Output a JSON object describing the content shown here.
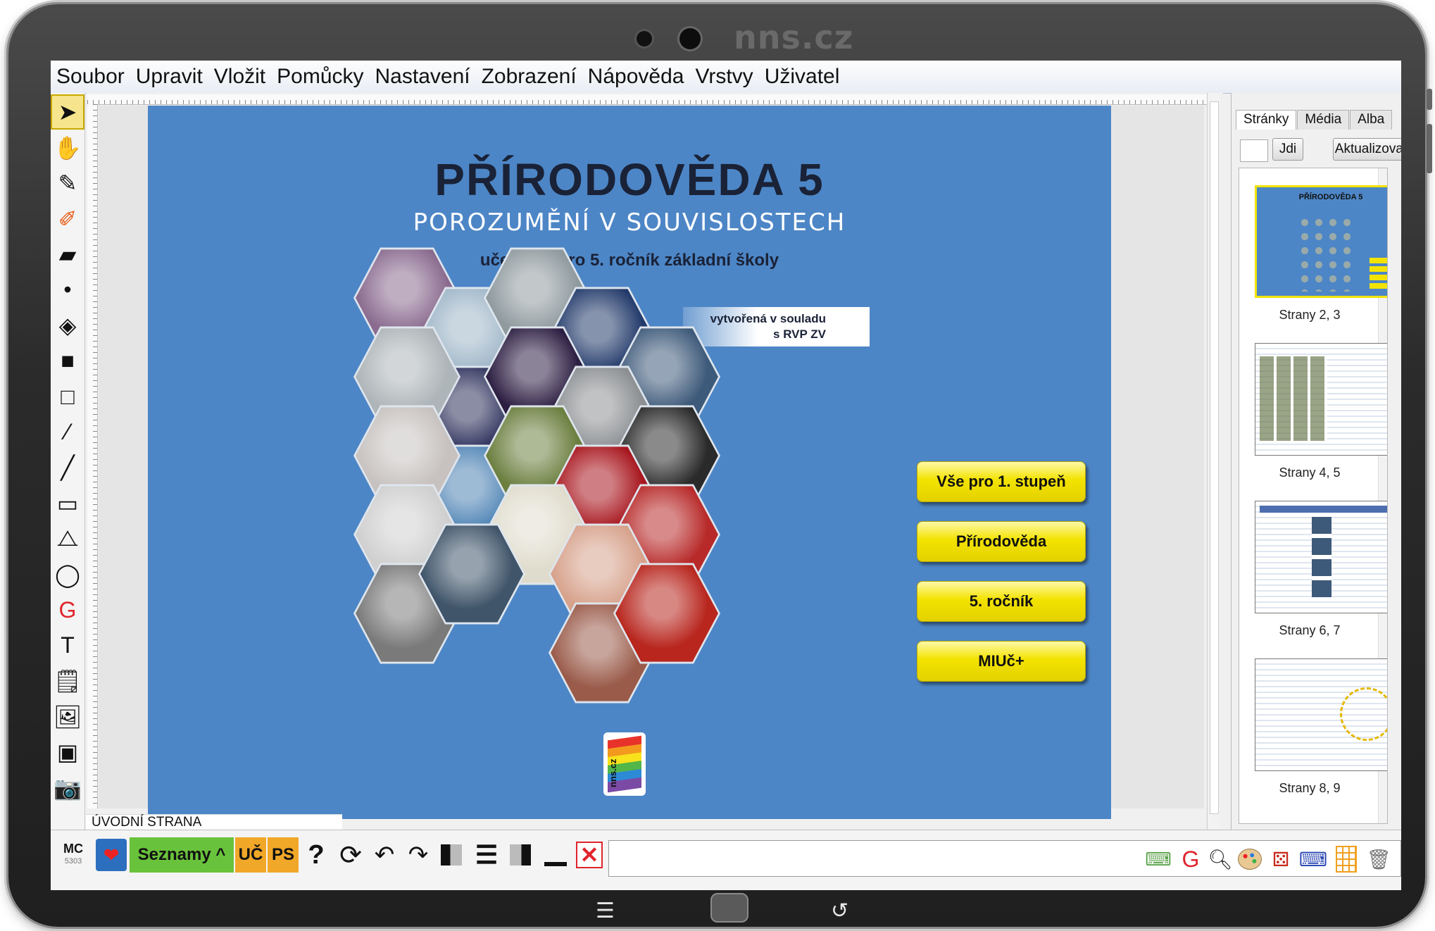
{
  "device": {
    "brand": "nns.cz"
  },
  "menu": [
    "Soubor",
    "Upravit",
    "Vložit",
    "Pomůcky",
    "Nastavení",
    "Zobrazení",
    "Nápověda",
    "Vrstvy",
    "Uživatel"
  ],
  "left_tools": [
    {
      "name": "select-arrow-icon",
      "glyph": "➤"
    },
    {
      "name": "hand-icon",
      "glyph": "✋"
    },
    {
      "name": "pen-icon",
      "glyph": "✎"
    },
    {
      "name": "highlighter-icon",
      "glyph": "✐"
    },
    {
      "name": "eraser-icon",
      "glyph": "▰"
    },
    {
      "name": "dot-icon",
      "glyph": "•"
    },
    {
      "name": "fill-bucket-icon",
      "glyph": "◈"
    },
    {
      "name": "filled-square-icon",
      "glyph": "■"
    },
    {
      "name": "hollow-square-icon",
      "glyph": "□"
    },
    {
      "name": "eyedropper-icon",
      "glyph": "⁄"
    },
    {
      "name": "line-icon",
      "glyph": "╱"
    },
    {
      "name": "rectangle-icon",
      "glyph": "▭"
    },
    {
      "name": "polygon-icon",
      "glyph": "⧍"
    },
    {
      "name": "ellipse-icon",
      "glyph": "◯"
    },
    {
      "name": "handwriting-g-icon",
      "glyph": "G"
    },
    {
      "name": "text-icon",
      "glyph": "T"
    },
    {
      "name": "add-note-icon",
      "glyph": "🗒"
    },
    {
      "name": "add-image-icon",
      "glyph": "🖼"
    },
    {
      "name": "add-media-icon",
      "glyph": "▣"
    },
    {
      "name": "camera-icon",
      "glyph": "📷"
    }
  ],
  "slide": {
    "title": "PŘÍRODOVĚDA 5",
    "subtitle": "POROZUMĚNÍ V SOUVISLOSTECH",
    "subtitle2": "učebnice pro 5. ročník základní školy",
    "rvp_line1": "vytvořená v souladu",
    "rvp_line2": "s RVP ZV",
    "logo_text": "nns.cz",
    "buttons": [
      "Vše pro 1. stupeň",
      "Přírodověda",
      "5. ročník",
      "MIUč+"
    ],
    "hex_colors": [
      "#8a6b8f",
      "#9fb6c8",
      "#8f9a9e",
      "#2b2f5a",
      "#aeb5b8",
      "#223a6a",
      "#2c1e42",
      "#3e5a7a",
      "#4f84b5",
      "#8c8f92",
      "#c7c2c0",
      "#6b7f3f",
      "#2a2a2a",
      "#d9b7a6",
      "#a8161e",
      "#cfcfcf",
      "#e0dccd",
      "#b82a2a",
      "#d7a28c",
      "#7a7a7a",
      "#40556a",
      "#9a5b4a",
      "#b8261e"
    ]
  },
  "page_label": "ÚVODNÍ STRANA",
  "right_panel": {
    "tabs": [
      "Stránky",
      "Média",
      "Alba"
    ],
    "go_button": "Jdi",
    "refresh_button": "Aktualizovat",
    "thumbnails": [
      {
        "label": "Strany 2, 3"
      },
      {
        "label": "Strany 4, 5"
      },
      {
        "label": "Strany 6, 7"
      },
      {
        "label": "Strany 8, 9"
      }
    ],
    "thumb_title": "PŘÍRODOVĚDA 5"
  },
  "bottom_toolbar": {
    "mc_label": "MC",
    "mc_number": "5303",
    "lists_button": "Seznamy ^",
    "uc_button": "UČ",
    "ps_button": "PS",
    "help_glyph": "?"
  },
  "colors": {
    "slide_bg": "#4d86c6",
    "button_yellow": "#f3e300",
    "lists_green": "#69c23b",
    "uc_orange": "#f1a728"
  }
}
